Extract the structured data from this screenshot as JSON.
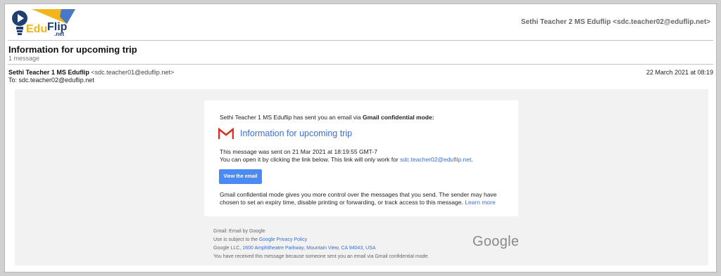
{
  "brand": {
    "logo_text_a": "Edu",
    "logo_text_b": "Flip",
    "logo_text_c": ".net"
  },
  "account": "Sethi Teacher 2 MS Eduflip <sdc.teacher02@eduflip.net>",
  "email": {
    "subject": "Information for upcoming trip",
    "message_count": "1 message",
    "from_name": "Sethi Teacher 1 MS Eduflip",
    "from_address": "<sdc.teacher01@eduflip.net>",
    "to": "To: sdc.teacher02@eduflip.net",
    "date": "22 March 2021 at 08:19"
  },
  "card": {
    "intro_text": "Sethi Teacher 1 MS Eduflip has sent you an email via ",
    "intro_bold": "Gmail confidential mode:",
    "title": "Information for upcoming trip",
    "sent_line": "This message was sent on 21 Mar 2021 at 18:19:55 GMT-7",
    "open_line": "You can open it by clicking the link below. This link will only work for ",
    "open_link": "sdc.teacher02@eduflip.net",
    "open_end": ".",
    "button_label": "View the email",
    "info_line1": "Gmail confidential mode gives you more control over the messages that you send. The sender may have",
    "info_line2": "chosen to set an expiry time, disable printing or forwarding, or track access to this message.",
    "learn_more": "Learn more"
  },
  "footer": {
    "line1": "Gmail: Email by Google",
    "line2_pre": "Use is subject to the ",
    "line2_link": "Google Privacy Policy",
    "line3_pre": "Google LLC, ",
    "line3_link": "1600 Amphitheatre Parkway, Mountain View, CA 94043, USA",
    "line4": "You have received this message because someone sent you an email via Gmail confidential mode.",
    "google_logo": "Google"
  },
  "colors": {
    "link": "#3a6fd0",
    "button": "#4a8af4",
    "gmail_red": "#d93025",
    "logo_blue": "#1f3f73",
    "logo_gold": "#f2b51c"
  }
}
